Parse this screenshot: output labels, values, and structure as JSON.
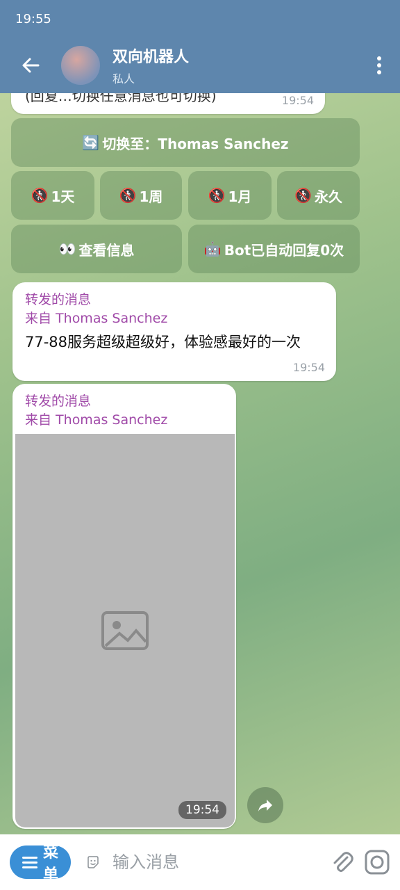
{
  "status": {
    "time": "19:55"
  },
  "header": {
    "title": "双向机器人",
    "subtitle": "私人"
  },
  "messages": [
    {
      "text": "(回复…切换任意消息也可切换)",
      "time": "19:54"
    },
    {
      "forward_label": "转发的消息",
      "from": "来自 Thomas Sanchez",
      "text": "77-88服务超级超级好，体验感最好的一次",
      "time": "19:54"
    },
    {
      "forward_label": "转发的消息",
      "from": "来自 Thomas Sanchez",
      "media_time": "19:54"
    }
  ],
  "keyboard": {
    "switch": "切换至：Thomas Sanchez",
    "ban_day": "1天",
    "ban_week": "1周",
    "ban_month": "1月",
    "ban_forever": "永久",
    "view_info": "查看信息",
    "auto_reply": "Bot已自动回复0次"
  },
  "icons": {
    "switch": "🔄",
    "ban": "🚷",
    "eyes": "👀",
    "robot": "🤖"
  },
  "input": {
    "menu_label": "菜单",
    "placeholder": "输入消息"
  },
  "colors": {
    "header": "#5e86ad",
    "accent": "#3a8fd6",
    "forward": "#a04aa8"
  }
}
